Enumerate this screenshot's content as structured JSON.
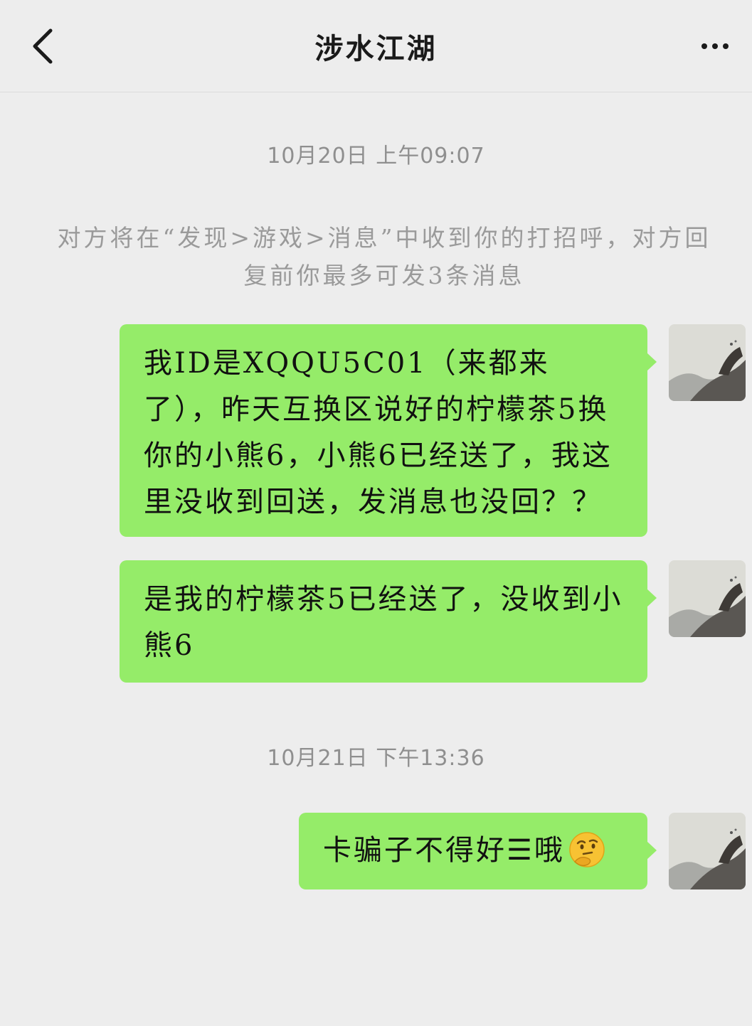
{
  "header": {
    "title": "涉水江湖",
    "back_icon": "chevron-left-icon",
    "more_icon": "more-dots-icon"
  },
  "chat": {
    "timestamps": [
      "10月20日 上午09:07",
      "10月21日 下午13:36"
    ],
    "system_notice": "对方将在“发现>游戏>消息”中收到你的打招呼，对方回复前你最多可发3条消息",
    "messages": [
      {
        "sender": "self",
        "text": "我ID是XQQU5C01（来都来了），昨天互换区说好的柠檬茶5换你的小熊6，小熊6已经送了，我这里没收到回送，发消息也没回？？"
      },
      {
        "sender": "self",
        "text": "是我的柠檬茶5已经送了，没收到小熊6"
      },
      {
        "sender": "self",
        "text": "卡骗子不得好☰哦",
        "emoji": "thinking-face-emoji"
      }
    ]
  },
  "colors": {
    "background": "#ededed",
    "bubble_self": "#95ec69",
    "timestamp_text": "#8f8f8f",
    "notice_text": "#9a9a9a"
  }
}
